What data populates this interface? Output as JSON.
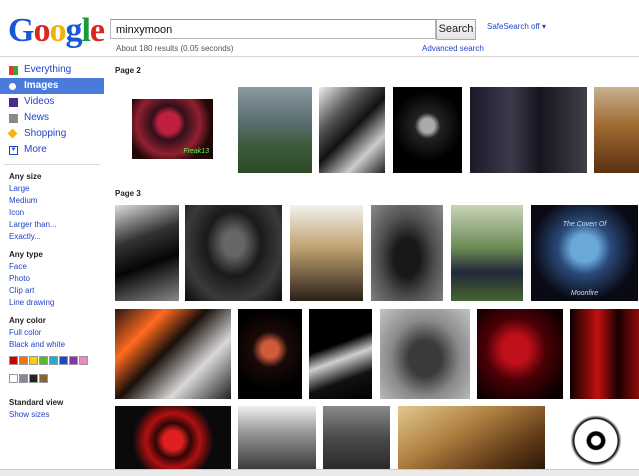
{
  "header": {
    "logo": [
      "G",
      "o",
      "o",
      "g",
      "l",
      "e"
    ],
    "query": "minxymoon",
    "search_label": "Search",
    "safesearch": "SafeSearch off ▾",
    "result_stats": "About 180 results (0.05 seconds)",
    "advanced_search": "Advanced search"
  },
  "sidebar": {
    "nav": [
      {
        "label": "Everything",
        "icon": "everything-icon"
      },
      {
        "label": "Images",
        "icon": "images-icon"
      },
      {
        "label": "Videos",
        "icon": "videos-icon"
      },
      {
        "label": "News",
        "icon": "news-icon"
      },
      {
        "label": "Shopping",
        "icon": "shopping-icon"
      },
      {
        "label": "More",
        "icon": "more-icon"
      }
    ],
    "size": {
      "title": "Any size",
      "options": [
        "Large",
        "Medium",
        "Icon",
        "Larger than...",
        "Exactly..."
      ]
    },
    "type": {
      "title": "Any type",
      "options": [
        "Face",
        "Photo",
        "Clip art",
        "Line drawing"
      ]
    },
    "color": {
      "title": "Any color",
      "options": [
        "Full color",
        "Black and white"
      ],
      "swatches": [
        "#cc0000",
        "#ee7711",
        "#f5d00f",
        "#55bb22",
        "#22aacc",
        "#2244cc",
        "#8833aa",
        "#ee88bb",
        "#ffffff",
        "#888899",
        "#222222",
        "#886633"
      ]
    },
    "view": {
      "title": "Standard view",
      "option": "Show sizes"
    }
  },
  "results": {
    "page2_label": "Page 2",
    "page3_label": "Page 3",
    "captions": {
      "freak": "Freak13",
      "coven": "The Coven Of",
      "moonfire": "Moonfire"
    }
  }
}
